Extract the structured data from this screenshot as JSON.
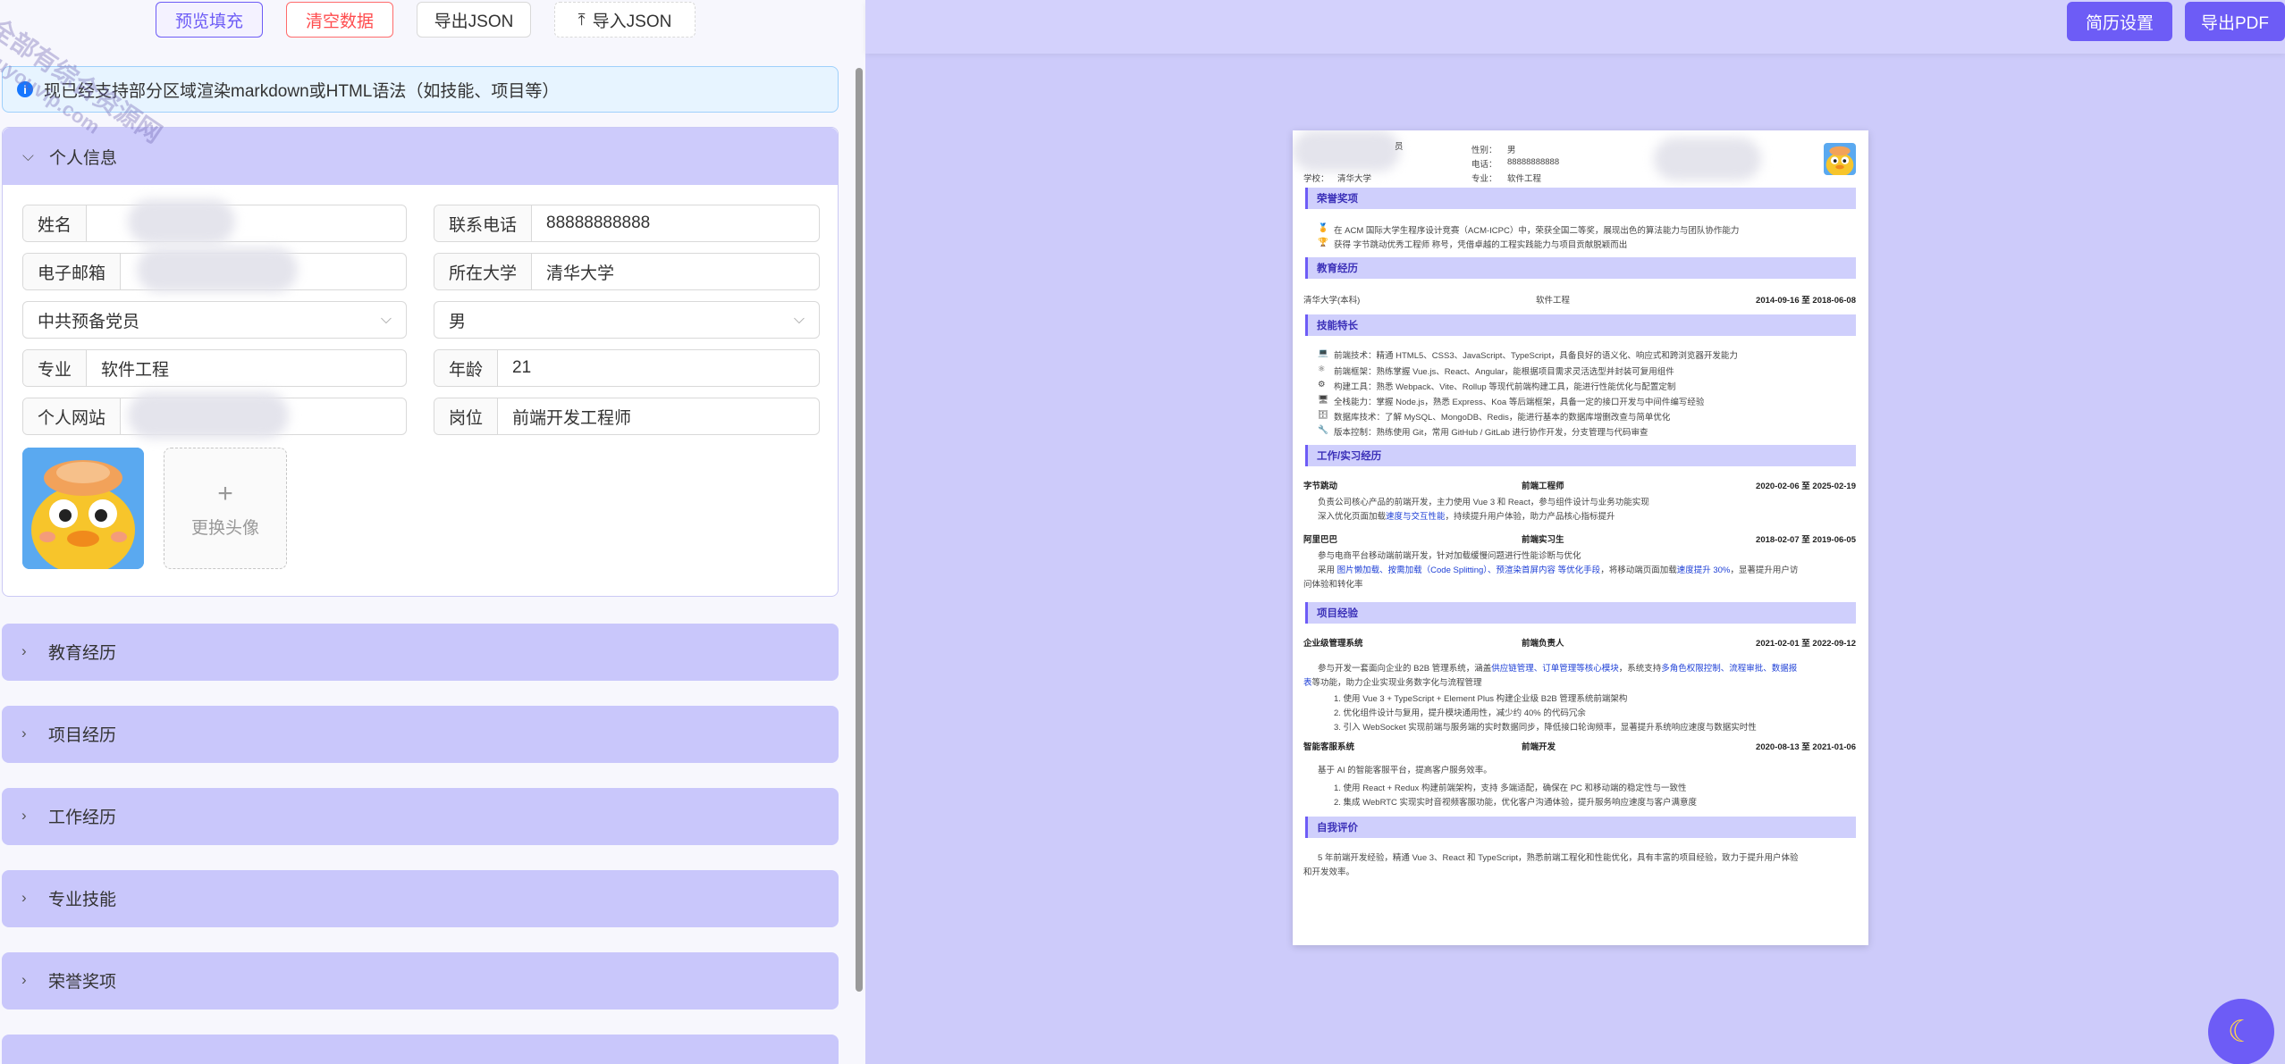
{
  "toolbar": {
    "preview_fill": "预览填充",
    "clear_data": "清空数据",
    "export_json": "导出JSON",
    "import_json": "导入JSON"
  },
  "notice": {
    "text": "现已经支持部分区域渲染markdown或HTML语法（如技能、项目等）"
  },
  "personal": {
    "title": "个人信息",
    "name_label": "姓名",
    "phone_label": "联系电话",
    "phone_value": "88888888888",
    "email_label": "电子邮箱",
    "school_label": "所在大学",
    "school_value": "清华大学",
    "politics_value": "中共预备党员",
    "gender_value": "男",
    "major_label": "专业",
    "major_value": "软件工程",
    "age_label": "年龄",
    "age_value": "21",
    "website_label": "个人网站",
    "position_label": "岗位",
    "position_value": "前端开发工程师",
    "change_avatar": "更换头像"
  },
  "sections": [
    {
      "title": "教育经历"
    },
    {
      "title": "项目经历"
    },
    {
      "title": "工作经历"
    },
    {
      "title": "专业技能"
    },
    {
      "title": "荣誉奖项"
    }
  ],
  "right_toolbar": {
    "resume_settings": "简历设置",
    "export_pdf": "导出PDF"
  },
  "resume": {
    "header": {
      "gender_label": "性别：",
      "gender": "男",
      "phone_label": "电话：",
      "phone": "88888888888",
      "school_label": "学校：",
      "school": "清华大学",
      "major_label": "专业：",
      "major": "软件工程",
      "job_suffix": "员"
    },
    "honors": {
      "title": "荣誉奖项",
      "items": [
        "在 ACM 国际大学生程序设计竞赛（ACM-ICPC）中，荣获全国二等奖，展现出色的算法能力与团队协作能力",
        "获得 字节跳动优秀工程师 称号，凭借卓越的工程实践能力与项目贡献脱颖而出"
      ]
    },
    "education": {
      "title": "教育经历",
      "school": "清华大学(本科)",
      "major": "软件工程",
      "period": "2014-09-16 至 2018-06-08"
    },
    "skills": {
      "title": "技能特长",
      "items": [
        "前端技术：精通 HTML5、CSS3、JavaScript、TypeScript，具备良好的语义化、响应式和跨浏览器开发能力",
        "前端框架：熟练掌握 Vue.js、React、Angular，能根据项目需求灵活选型并封装可复用组件",
        "构建工具：熟悉 Webpack、Vite、Rollup 等现代前端构建工具，能进行性能优化与配置定制",
        "全栈能力：掌握 Node.js，熟悉 Express、Koa 等后端框架，具备一定的接口开发与中间件编写经验",
        "数据库技术：了解 MySQL、MongoDB、Redis，能进行基本的数据库增删改查与简单优化",
        "版本控制：熟练使用 Git，常用 GitHub / GitLab 进行协作开发，分支管理与代码审查"
      ]
    },
    "work": {
      "title": "工作/实习经历",
      "entries": [
        {
          "company": "字节跳动",
          "role": "前端工程师",
          "period": "2020-02-06 至 2025-02-19",
          "line1": "负责公司核心产品的前端开发，主力使用 Vue 3 和 React，参与组件设计与业务功能实现",
          "line2a": "深入优化页面加载",
          "line2hl": "速度与交互性能",
          "line2b": "，持续提升用户体验，助力产品核心指标提升"
        },
        {
          "company": "阿里巴巴",
          "role": "前端实习生",
          "period": "2018-02-07 至 2019-06-05",
          "line1": "参与电商平台移动端前端开发，针对加载缓慢问题进行性能诊断与优化",
          "line2a": "采用 ",
          "line2hl": "图片懒加载、按需加载（Code Splitting）、预渲染首屏内容 等优化手段",
          "line2b": "，将移动端页面加载",
          "line2hl2": "速度提升 30%",
          "line2c": "，显著提升用户访",
          "line3": "问体验和转化率"
        }
      ]
    },
    "projects": {
      "title": "项目经验",
      "entries": [
        {
          "name": "企业级管理系统",
          "role": "前端负责人",
          "period": "2021-02-01 至 2022-09-12",
          "desc_a": "参与开发一套面向企业的 B2B 管理系统，涵盖",
          "desc_hl": "供应链管理、订单管理等核心模块",
          "desc_b": "，系统支持",
          "desc_hl2": "多角色权限控制、流程审批、数据报",
          "desc2_hl": "表",
          "desc2_b": "等功能，助力企业实现业务数字化与流程管理",
          "items": [
            "1. 使用 Vue 3 + TypeScript + Element Plus 构建企业级 B2B 管理系统前端架构",
            "2. 优化组件设计与复用，提升模块通用性，减少约 40% 的代码冗余",
            "3. 引入 WebSocket 实现前端与服务端的实时数据同步，降低接口轮询频率，显著提升系统响应速度与数据实时性"
          ]
        },
        {
          "name": "智能客服系统",
          "role": "前端开发",
          "period": "2020-08-13 至 2021-01-06",
          "desc": "基于 AI 的智能客服平台，提高客户服务效率。",
          "items": [
            "1. 使用 React + Redux 构建前端架构，支持 多端适配，确保在 PC 和移动端的稳定性与一致性",
            "2. 集成 WebRTC 实现实时音视频客服功能，优化客户沟通体验，提升服务响应速度与客户满意度"
          ]
        }
      ]
    },
    "evaluation": {
      "title": "自我评价",
      "line1": "5 年前端开发经验，精通 Vue 3、React 和 TypeScript，熟悉前端工程化和性能优化，具有丰富的项目经验，致力于提升用户体验",
      "line2": "和开发效率。"
    }
  },
  "watermark": {
    "line1": "全部有综合资源网",
    "line2": "douyouvip.com"
  },
  "colors": {
    "accent": "#6d5cf6",
    "panel": "#c9c7fb",
    "preview_bg": "#cdcbfa",
    "link": "#1d3fd6"
  }
}
